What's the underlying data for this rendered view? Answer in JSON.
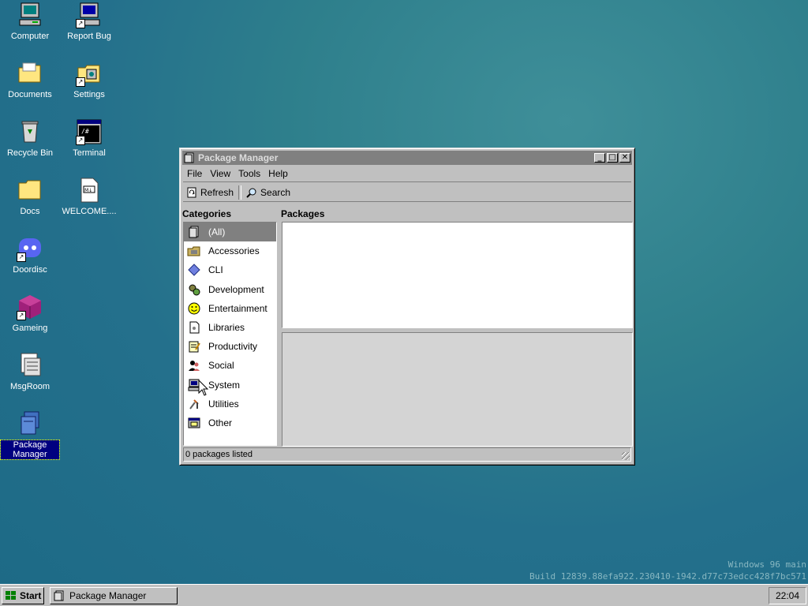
{
  "desktop": {
    "icons": [
      {
        "label": "Computer",
        "icon": "computer-icon"
      },
      {
        "label": "Report Bug",
        "icon": "report-bug-icon"
      },
      {
        "label": "Documents",
        "icon": "documents-folder-icon"
      },
      {
        "label": "Settings",
        "icon": "settings-icon"
      },
      {
        "label": "Recycle Bin",
        "icon": "recycle-bin-icon"
      },
      {
        "label": "Terminal",
        "icon": "terminal-icon"
      },
      {
        "label": "Docs",
        "icon": "folder-icon"
      },
      {
        "label": "WELCOME....",
        "icon": "markdown-file-icon"
      },
      {
        "label": "Doordisc",
        "icon": "doordisc-icon"
      },
      {
        "label": "Gameing",
        "icon": "gameing-icon"
      },
      {
        "label": "MsgRoom",
        "icon": "msgroom-icon"
      },
      {
        "label": "Package Manager",
        "icon": "package-manager-icon",
        "selected": true
      }
    ]
  },
  "window": {
    "title": "Package Manager",
    "menu": [
      "File",
      "View",
      "Tools",
      "Help"
    ],
    "toolbar": {
      "refresh_label": "Refresh",
      "search_label": "Search"
    },
    "categories_heading": "Categories",
    "packages_heading": "Packages",
    "categories": [
      {
        "label": "(All)",
        "icon": "all-icon",
        "selected": true
      },
      {
        "label": "Accessories",
        "icon": "accessories-icon"
      },
      {
        "label": "CLI",
        "icon": "cli-icon"
      },
      {
        "label": "Development",
        "icon": "development-icon"
      },
      {
        "label": "Entertainment",
        "icon": "entertainment-icon"
      },
      {
        "label": "Libraries",
        "icon": "libraries-icon"
      },
      {
        "label": "Productivity",
        "icon": "productivity-icon"
      },
      {
        "label": "Social",
        "icon": "social-icon"
      },
      {
        "label": "System",
        "icon": "system-icon"
      },
      {
        "label": "Utilities",
        "icon": "utilities-icon"
      },
      {
        "label": "Other",
        "icon": "other-icon"
      }
    ],
    "status": "0 packages listed"
  },
  "watermark": {
    "line1": "Windows 96 main",
    "line2": "Build 12839.88efa922.230410-1942.d77c73edcc428f7bc571"
  },
  "taskbar": {
    "start_label": "Start",
    "task_label": "Package Manager",
    "clock": "22:04"
  },
  "colors": {
    "desktop": "#2a7a8c",
    "titlebar_inactive": "#808080",
    "selection": "#000080",
    "chrome": "#c0c0c0"
  }
}
